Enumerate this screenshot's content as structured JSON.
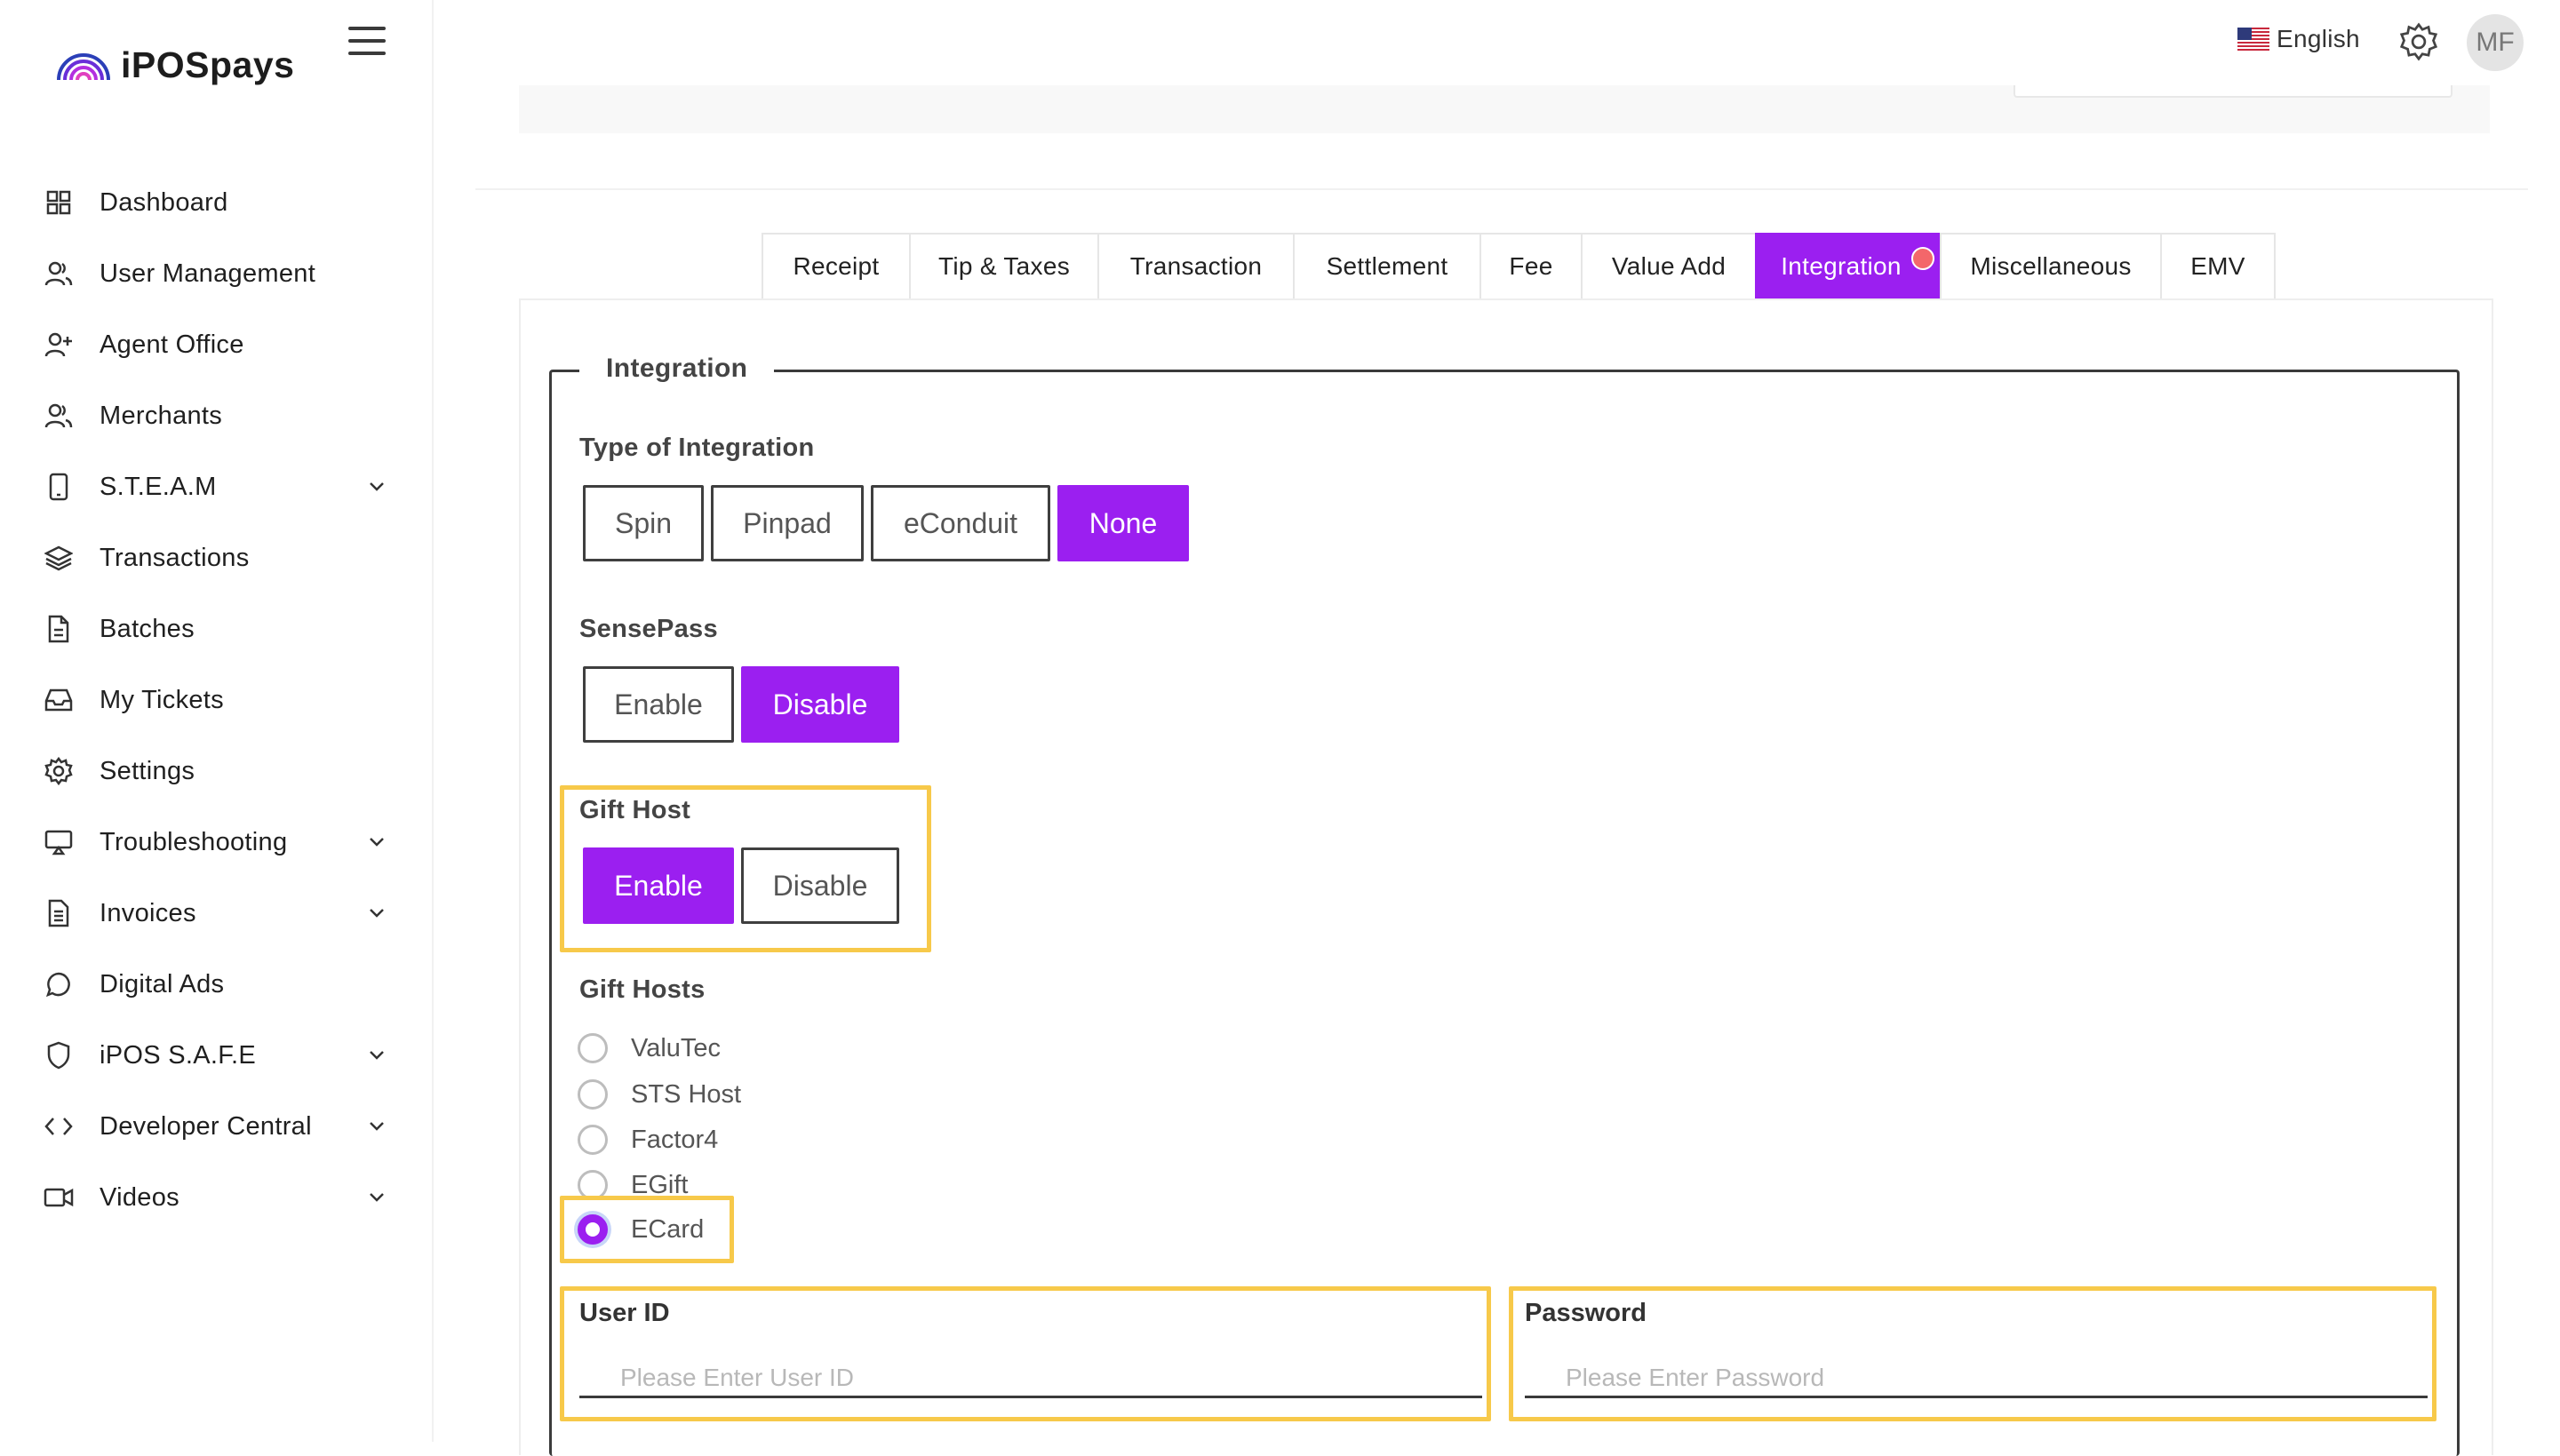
{
  "brand": {
    "name": "iPOSpays",
    "accent": "#9b1ff0"
  },
  "sidebar": {
    "items": [
      {
        "label": "Dashboard",
        "icon": "grid-icon",
        "has_chevron": false
      },
      {
        "label": "User Management",
        "icon": "users-icon",
        "has_chevron": false
      },
      {
        "label": "Agent Office",
        "icon": "user-plus-icon",
        "has_chevron": false
      },
      {
        "label": "Merchants",
        "icon": "users-icon",
        "has_chevron": false
      },
      {
        "label": "S.T.E.A.M",
        "icon": "tablet-icon",
        "has_chevron": true
      },
      {
        "label": "Transactions",
        "icon": "layers-icon",
        "has_chevron": false
      },
      {
        "label": "Batches",
        "icon": "file-icon",
        "has_chevron": false
      },
      {
        "label": "My Tickets",
        "icon": "inbox-icon",
        "has_chevron": false
      },
      {
        "label": "Settings",
        "icon": "gear-icon",
        "has_chevron": false
      },
      {
        "label": "Troubleshooting",
        "icon": "monitor-icon",
        "has_chevron": true
      },
      {
        "label": "Invoices",
        "icon": "invoice-icon",
        "has_chevron": true
      },
      {
        "label": "Digital Ads",
        "icon": "chat-bubble-icon",
        "has_chevron": false
      },
      {
        "label": "iPOS S.A.F.E",
        "icon": "shield-icon",
        "has_chevron": true
      },
      {
        "label": "Developer Central",
        "icon": "code-icon",
        "has_chevron": true
      },
      {
        "label": "Videos",
        "icon": "video-icon",
        "has_chevron": true
      }
    ]
  },
  "header": {
    "language": "English",
    "avatar_initials": "MF"
  },
  "tabs": [
    {
      "label": "Receipt",
      "active": false
    },
    {
      "label": "Tip & Taxes",
      "active": false
    },
    {
      "label": "Transaction",
      "active": false
    },
    {
      "label": "Settlement",
      "active": false
    },
    {
      "label": "Fee",
      "active": false
    },
    {
      "label": "Value Add",
      "active": false
    },
    {
      "label": "Integration",
      "active": true
    },
    {
      "label": "Miscellaneous",
      "active": false
    },
    {
      "label": "EMV",
      "active": false
    }
  ],
  "integration": {
    "legend": "Integration",
    "type_label": "Type of Integration",
    "type_options": [
      "Spin",
      "Pinpad",
      "eConduit",
      "None"
    ],
    "type_selected": "None",
    "sensepass_label": "SensePass",
    "sensepass_options": [
      "Enable",
      "Disable"
    ],
    "sensepass_selected": "Disable",
    "gifthost_label": "Gift Host",
    "gifthost_options": [
      "Enable",
      "Disable"
    ],
    "gifthost_selected": "Enable",
    "gifthosts_label": "Gift Hosts",
    "gifthosts_options": [
      "ValuTec",
      "STS Host",
      "Factor4",
      "EGift",
      "ECard"
    ],
    "gifthosts_selected": "ECard",
    "userid_label": "User ID",
    "userid_placeholder": "Please Enter User ID",
    "password_label": "Password",
    "password_placeholder": "Please Enter Password"
  }
}
